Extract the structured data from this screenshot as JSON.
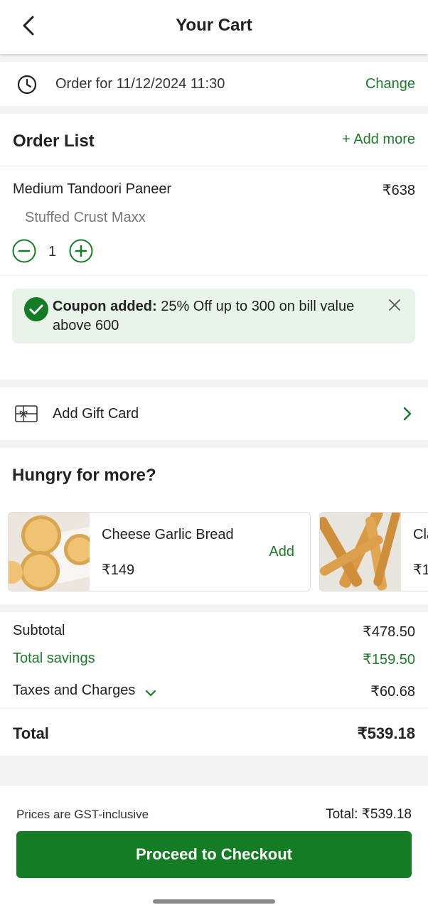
{
  "header": {
    "title": "Your Cart"
  },
  "order_time": {
    "text": "Order for 11/12/2024 11:30",
    "change_label": "Change"
  },
  "order_list": {
    "title": "Order List",
    "add_more_label": "+ Add more",
    "items": [
      {
        "name": "Medium Tandoori Paneer",
        "price": "₹638",
        "variant": "Stuffed Crust Maxx",
        "quantity": "1"
      }
    ]
  },
  "coupon": {
    "label": "Coupon added:",
    "description": " 25% Off up to 300 on bill value above 600"
  },
  "gift_card": {
    "label": "Add Gift Card"
  },
  "recommendations": {
    "title": "Hungry for more?",
    "items": [
      {
        "name": "Cheese Garlic Bread",
        "price": "₹149",
        "add_label": "Add"
      },
      {
        "name": "Cla",
        "price": "₹1"
      }
    ]
  },
  "bill": {
    "subtotal_label": "Subtotal",
    "subtotal": "₹478.50",
    "savings_label": "Total savings",
    "savings": "₹159.50",
    "taxes_label": "Taxes and Charges",
    "taxes": "₹60.68",
    "total_label": "Total",
    "total": "₹539.18"
  },
  "footer": {
    "gst_note": "Prices are GST-inclusive",
    "total_text": "Total: ₹539.18",
    "checkout_label": "Proceed to Checkout"
  },
  "colors": {
    "brand_green": "#137c24",
    "link_green": "#1c7c2c",
    "coupon_bg": "#e8f3ea"
  }
}
